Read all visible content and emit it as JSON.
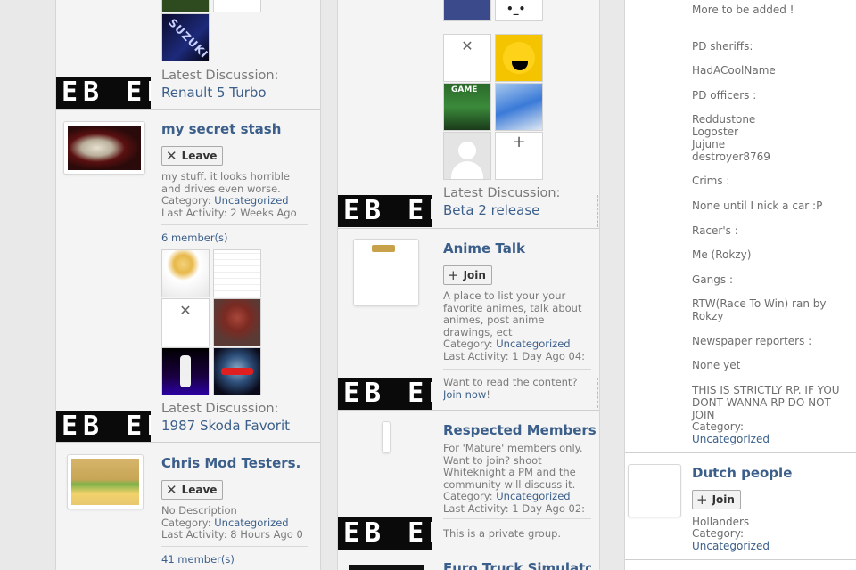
{
  "col1": {
    "top_latest_label": "Latest Discussion:",
    "top_latest_link": "Renault 5 Turbo",
    "top_tile_text": "SUZUKI",
    "group1": {
      "name": "my secret stash",
      "button": "Leave",
      "desc_line1": "my stuff. it looks horrible",
      "desc_line2": "and drives even worse.",
      "category_label": "Category:",
      "category": "Uncategorized",
      "activity": "Last Activity: 2 Weeks Ago",
      "members": "6 member(s)",
      "latest_label": "Latest Discussion:",
      "latest_link": "1987 Skoda Favorit"
    },
    "group2": {
      "name": "Chris Mod Testers.",
      "button": "Leave",
      "desc": "No Description",
      "category_label": "Category:",
      "category": "Uncategorized",
      "activity": "Last Activity: 8 Hours Ago 0",
      "members": "41 member(s)"
    }
  },
  "col2": {
    "latest_label": "Latest Discussion:",
    "latest_link": "Beta 2 release",
    "game_tile_text": "GAME",
    "group1": {
      "name": "Anime Talk",
      "button": "Join",
      "desc_line1": "A place to list your your",
      "desc_line2": "favorite animes, talk about",
      "desc_line3": "animes, post anime",
      "desc_line4": "drawings, ect",
      "category_label": "Category:",
      "category": "Uncategorized",
      "activity": "Last Activity: 1 Day Ago 04:",
      "read_prompt": "Want to read the content?",
      "join_now": "Join now",
      "join_now_suffix": "!"
    },
    "group2": {
      "name": "Respected Members",
      "desc_line1": "For 'Mature' members only.",
      "desc_line2": "Want to join? shoot",
      "desc_line3": "Whiteknight a PM and the",
      "desc_line4": "community will discuss it.",
      "category_label": "Category:",
      "category": "Uncategorized",
      "activity": "Last Activity: 1 Day Ago 02:",
      "private_note": "This is a private group."
    },
    "group3": {
      "name": "Euro Truck Simulator"
    }
  },
  "col3": {
    "lines": [
      "More to be added !",
      "PD sheriffs:",
      "HadACoolName",
      "PD officers :",
      "Reddustone",
      "Logoster",
      "Jujune",
      "destroyer8769",
      "Crims :",
      "None until I nick a car :P",
      "Racer's :",
      "Me (Rokzy)",
      "Gangs :",
      "RTW(Race To Win) ran by",
      "Rokzy",
      "Newspaper reporters :",
      "None yet",
      "THIS IS STRICTLY RP. IF YOU",
      "DONT WANNA RP DO NOT",
      "JOIN"
    ],
    "category_label": "Category:",
    "category": "Uncategorized",
    "group": {
      "name": "Dutch people",
      "button": "Join",
      "desc": "Hollanders",
      "category_label": "Category:",
      "category": "Uncategorized"
    }
  },
  "banner_text": "EB EB",
  "colors": {
    "link": "#3b5f8a",
    "muted": "#7a7a7a",
    "banner": "#0a0a0a"
  }
}
